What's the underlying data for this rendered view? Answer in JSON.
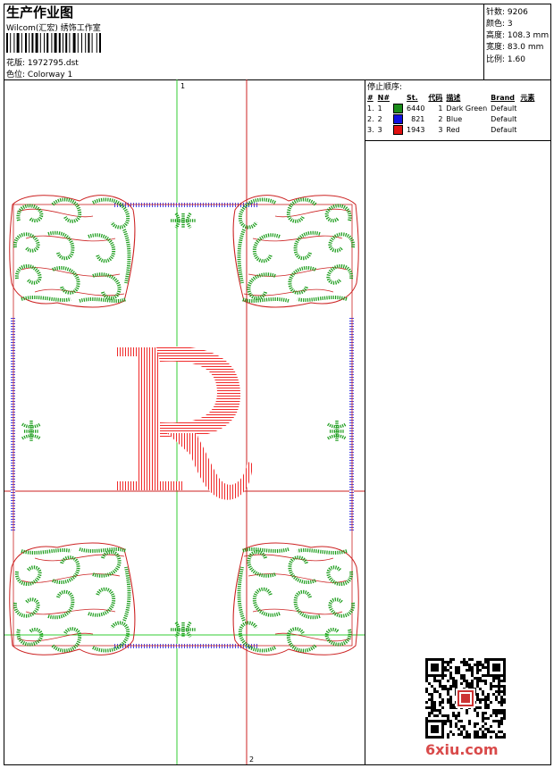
{
  "header": {
    "title": "生产作业图",
    "subtitle": "Wilcom(汇宏) 绣饰工作室",
    "design_label": "花版:",
    "design_file": "1972795.dst",
    "colorway_label": "色位:",
    "colorway": "Colorway 1"
  },
  "stats": {
    "stitches_label": "针数:",
    "stitches": "9206",
    "colors_label": "颜色:",
    "colors": "3",
    "height_label": "高度:",
    "height": "108.3 mm",
    "width_label": "宽度:",
    "width": "83.0 mm",
    "scale_label": "比例:",
    "scale": "1.60"
  },
  "stop_sequence": {
    "title": "停止顺序:",
    "columns": [
      "#",
      "N#",
      "St.",
      "代码",
      "描述",
      "Brand",
      "元素"
    ],
    "rows": [
      {
        "num": "1.",
        "n": "1",
        "color": "#1a8c1a",
        "st": "6440",
        "code": "1",
        "desc": "Dark Green",
        "brand": "Default"
      },
      {
        "num": "2.",
        "n": "2",
        "color": "#1010e0",
        "st": "821",
        "code": "2",
        "desc": "Blue",
        "brand": "Default"
      },
      {
        "num": "3.",
        "n": "3",
        "color": "#e01010",
        "st": "1943",
        "code": "3",
        "desc": "Red",
        "brand": "Default"
      }
    ]
  },
  "canvas": {
    "axis_top_label": "1",
    "axis_bottom_label": "2",
    "letter": "R"
  },
  "watermark": "6xiu.com",
  "colors": {
    "green": "#1a9c1a",
    "blue": "#1414e6",
    "red": "#ee1111",
    "guide_green": "#33cc33",
    "guide_red": "#cc2222"
  }
}
